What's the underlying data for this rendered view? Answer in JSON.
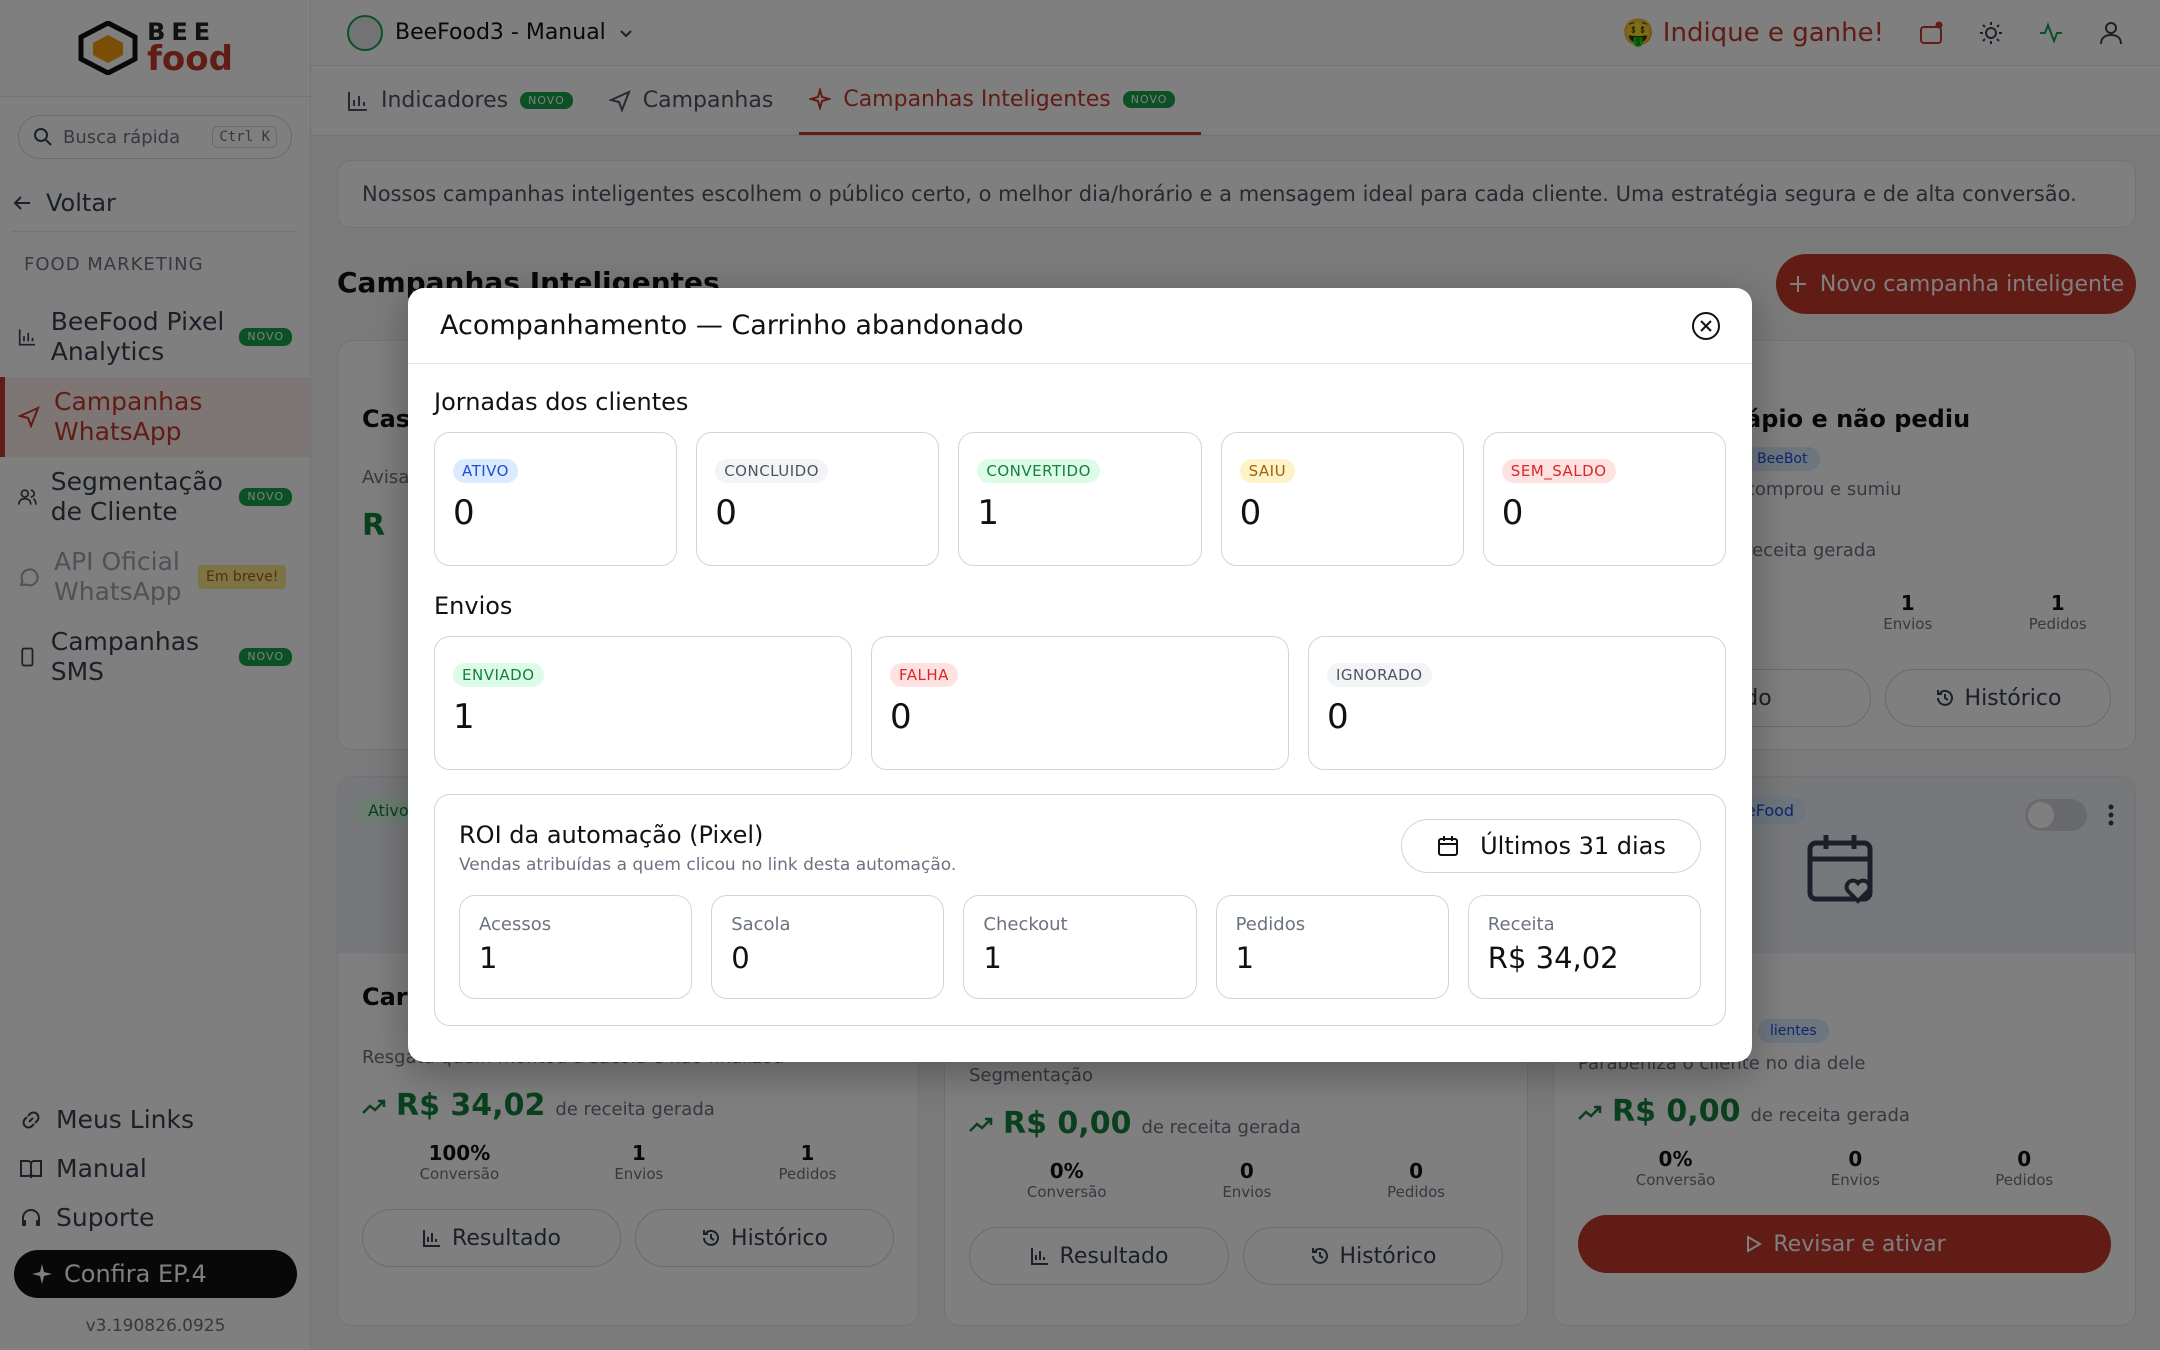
{
  "app": {
    "logo_top": "BEE",
    "logo_bottom": "food",
    "store_name": "BeeFood3 - Manual",
    "indique": "🤑 Indique e ganhe!"
  },
  "sidebar": {
    "search_placeholder": "Busca rápida",
    "search_shortcut": "Ctrl K",
    "back_label": "Voltar",
    "section_label": "FOOD MARKETING",
    "items": [
      {
        "label": "BeeFood Pixel Analytics",
        "badge": "NOVO"
      },
      {
        "label": "Campanhas WhatsApp",
        "badge": ""
      },
      {
        "label": "Segmentação de Cliente",
        "badge": "NOVO"
      },
      {
        "label": "API Oficial WhatsApp",
        "badge": "Em breve!"
      },
      {
        "label": "Campanhas SMS",
        "badge": "NOVO"
      }
    ],
    "bottom_links": [
      "Meus Links",
      "Manual",
      "Suporte"
    ],
    "confira": "Confira EP.4",
    "version": "v3.190826.0925"
  },
  "tabs": [
    {
      "label": "Indicadores",
      "badge": "NOVO"
    },
    {
      "label": "Campanhas",
      "badge": ""
    },
    {
      "label": "Campanhas Inteligentes",
      "badge": "NOVO"
    }
  ],
  "main": {
    "info_text": "Nossos campanhas inteligentes escolhem o público certo, o melhor dia/horário e a mensagem ideal para cada cliente. Uma estratégia segura e de alta conversão.",
    "page_title": "Campanhas Inteligentes",
    "new_button": "Novo campanha inteligente"
  },
  "cards": {
    "top_left": {
      "title": "Cas",
      "desc": "Avisa",
      "revenue_prefix": "R"
    },
    "top_right": {
      "title": "ápio e não pediu",
      "tag": "BeeBot",
      "desc": "comprou e sumiu",
      "rev_label": "receita gerada",
      "stats": [
        {
          "v": "1",
          "l": "Envios"
        },
        {
          "v": "1",
          "l": "Pedidos"
        }
      ],
      "btn_left": "do",
      "btn_right": "Histórico"
    },
    "bottom_left": {
      "status": "Ativo",
      "title": "Carr",
      "desc": "Resgata quem montou a sacola e não finalizou",
      "revenue": "R$ 34,02",
      "rev_label": "de receita gerada",
      "stats": [
        {
          "v": "100%",
          "l": "Conversão"
        },
        {
          "v": "1",
          "l": "Envios"
        },
        {
          "v": "1",
          "l": "Pedidos"
        }
      ],
      "btn_left": "Resultado",
      "btn_right": "Histórico"
    },
    "bottom_mid": {
      "desc": "Segmentação",
      "revenue": "R$ 0,00",
      "rev_label": "de receita gerada",
      "stats": [
        {
          "v": "0%",
          "l": "Conversão"
        },
        {
          "v": "0",
          "l": "Envios"
        },
        {
          "v": "0",
          "l": "Pedidos"
        }
      ],
      "btn_left": "Resultado",
      "btn_right": "Histórico"
    },
    "bottom_right": {
      "tag": "eeFood",
      "tag2": "lientes",
      "desc": "Parabeniza o cliente no dia dele",
      "revenue": "R$ 0,00",
      "rev_label": "de receita gerada",
      "stats": [
        {
          "v": "0%",
          "l": "Conversão"
        },
        {
          "v": "0",
          "l": "Envios"
        },
        {
          "v": "0",
          "l": "Pedidos"
        }
      ],
      "btn_primary": "Revisar e ativar"
    }
  },
  "modal": {
    "title": "Acompanhamento — Carrinho abandonado",
    "journeys_title": "Jornadas dos clientes",
    "journeys": [
      {
        "status": "ATIVO",
        "value": "0",
        "color": "blue"
      },
      {
        "status": "CONCLUIDO",
        "value": "0",
        "color": "gray"
      },
      {
        "status": "CONVERTIDO",
        "value": "1",
        "color": "green"
      },
      {
        "status": "SAIU",
        "value": "0",
        "color": "yellow"
      },
      {
        "status": "SEM_SALDO",
        "value": "0",
        "color": "red"
      }
    ],
    "sends_title": "Envios",
    "sends": [
      {
        "status": "ENVIADO",
        "value": "1",
        "color": "green"
      },
      {
        "status": "FALHA",
        "value": "0",
        "color": "red"
      },
      {
        "status": "IGNORADO",
        "value": "0",
        "color": "gray"
      }
    ],
    "roi": {
      "title": "ROI da automação (Pixel)",
      "subtitle": "Vendas atribuídas a quem clicou no link desta automação.",
      "period": "Últimos 31 dias",
      "metrics": [
        {
          "label": "Acessos",
          "value": "1"
        },
        {
          "label": "Sacola",
          "value": "0"
        },
        {
          "label": "Checkout",
          "value": "1"
        },
        {
          "label": "Pedidos",
          "value": "1"
        },
        {
          "label": "Receita",
          "value": "R$ 34,02"
        }
      ]
    }
  },
  "colors": {
    "accent": "#c0392b",
    "success": "#15803d"
  }
}
